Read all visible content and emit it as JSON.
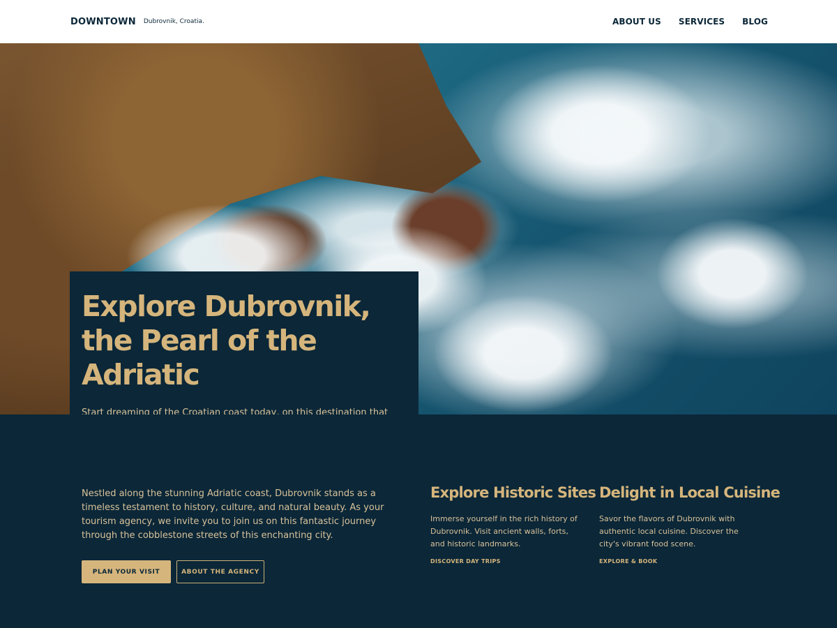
{
  "header": {
    "brand": "DOWNTOWN",
    "tagline": "Dubrovnik, Croatia.",
    "nav": [
      "ABOUT US",
      "SERVICES",
      "BLOG"
    ]
  },
  "hero": {
    "image": "coastal-rocks-and-waves",
    "title": "Explore Dubrovnik, the Pearl of the Adriatic",
    "subtitle": "Start dreaming of the Croatian coast today, on this destination that transcends time and captivates souls."
  },
  "intro": {
    "text": "Nestled along the stunning Adriatic coast, Dubrovnik stands as a timeless testament to history, culture, and natural beauty. As your tourism agency, we invite you to join us on this fantastic journey through the cobblestone streets of this enchanting city.",
    "primary_button": "PLAN YOUR VISIT",
    "secondary_button": "ABOUT THE AGENCY"
  },
  "features": [
    {
      "title": "Explore Historic Sites",
      "text": "Immerse yourself in the rich history of Dubrovnik. Visit ancient walls, forts, and historic landmarks.",
      "link": "DISCOVER DAY TRIPS"
    },
    {
      "title": "Delight in Local Cuisine",
      "text": "Savor the flavors of Dubrovnik with authentic local cuisine. Discover the city's vibrant food scene.",
      "link": "EXPLORE & BOOK"
    }
  ],
  "colors": {
    "navy": "#0b2738",
    "gold": "#d5b57c",
    "header_bg": "#ffffff"
  }
}
